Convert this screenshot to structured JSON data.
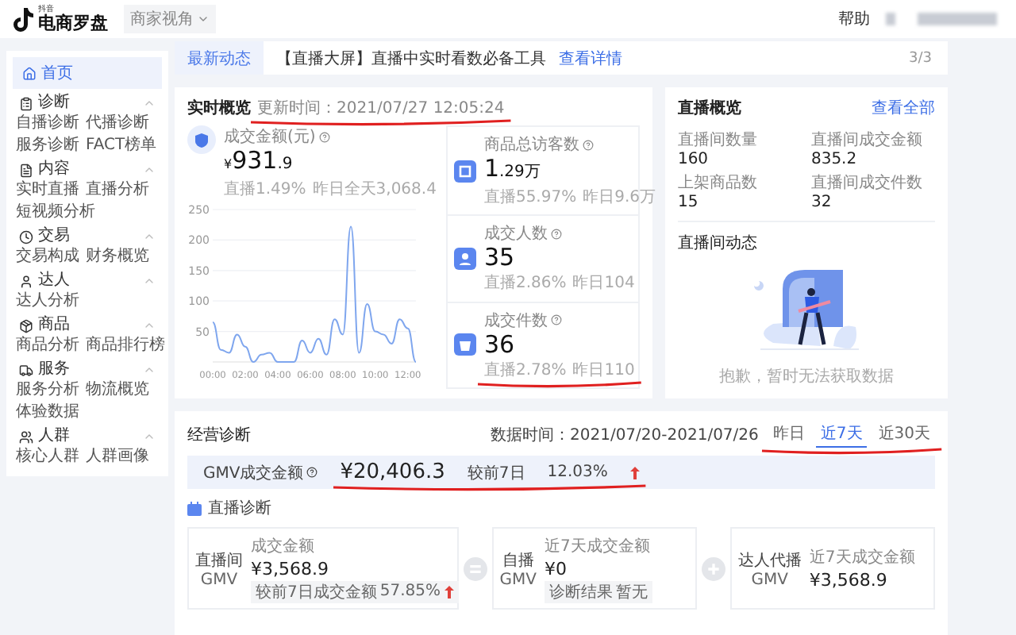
{
  "header": {
    "brand_small": "抖音",
    "brand": "电商罗盘",
    "view_switch": "商家视角",
    "help": "帮助"
  },
  "sidebar": {
    "items": [
      {
        "kind": "link",
        "label": "首页",
        "selected": true
      },
      {
        "kind": "group",
        "label": "诊断",
        "selected": false,
        "expanded": true,
        "children": [
          {
            "label": "自播诊断",
            "selected": false
          },
          {
            "label": "代播诊断",
            "selected": false
          },
          {
            "label": "服务诊断",
            "selected": false
          },
          {
            "label": "FACT榜单",
            "selected": false
          }
        ]
      },
      {
        "kind": "group",
        "label": "内容",
        "selected": false,
        "expanded": true,
        "children": [
          {
            "label": "实时直播",
            "selected": false
          },
          {
            "label": "直播分析",
            "selected": false
          },
          {
            "label": "短视频分析",
            "selected": false
          }
        ]
      },
      {
        "kind": "group",
        "label": "交易",
        "selected": false,
        "expanded": true,
        "children": [
          {
            "label": "交易构成",
            "selected": false
          },
          {
            "label": "财务概览",
            "selected": false
          }
        ]
      },
      {
        "kind": "group",
        "label": "达人",
        "selected": false,
        "expanded": true,
        "children": [
          {
            "label": "达人分析",
            "selected": false
          }
        ]
      },
      {
        "kind": "group",
        "label": "商品",
        "selected": false,
        "expanded": true,
        "children": [
          {
            "label": "商品分析",
            "selected": false
          },
          {
            "label": "商品排行榜",
            "selected": false
          }
        ]
      },
      {
        "kind": "group",
        "label": "服务",
        "selected": false,
        "expanded": true,
        "children": [
          {
            "label": "服务分析",
            "selected": false
          },
          {
            "label": "物流概览",
            "selected": false
          },
          {
            "label": "体验数据",
            "selected": false
          }
        ]
      },
      {
        "kind": "group",
        "label": "人群",
        "selected": false,
        "expanded": true,
        "children": [
          {
            "label": "核心人群",
            "selected": false
          },
          {
            "label": "人群画像",
            "selected": false
          }
        ]
      }
    ]
  },
  "notice": {
    "tab": "最新动态",
    "text": "【直播大屏】直播中实时看数必备工具",
    "link": "查看详情",
    "pager": "3/3"
  },
  "realtime": {
    "title": "实时概览",
    "updated": "更新时间：2021/07/27 12:05:24",
    "main": {
      "label": "成交金额(元)",
      "currency": "¥",
      "value": "931",
      "fraction": ".9",
      "live": "直播1.49%",
      "yesterday": "昨日全天3,068.4"
    },
    "chart_data": {
      "type": "line",
      "grid": true,
      "x": [
        0,
        0.5,
        1,
        1.5,
        2,
        2.5,
        3,
        3.5,
        4,
        4.5,
        5,
        5.5,
        6,
        6.5,
        7,
        7.5,
        8,
        8.5,
        9,
        9.5,
        10,
        10.5,
        11,
        11.5,
        12,
        12.5
      ],
      "series": [
        {
          "color": "#7fa6ee",
          "values": [
            65,
            20,
            15,
            45,
            25,
            0,
            12,
            15,
            0,
            0,
            0,
            35,
            15,
            38,
            12,
            70,
            45,
            222,
            15,
            95,
            50,
            45,
            30,
            70,
            55,
            0
          ]
        }
      ],
      "xlim": [
        0,
        12.5
      ],
      "ylim": [
        0,
        250
      ],
      "yticks": [
        50,
        100,
        150,
        200,
        250
      ],
      "xticks": [
        {
          "value": 0,
          "label": "00:00"
        },
        {
          "value": 2,
          "label": "02:00"
        },
        {
          "value": 4,
          "label": "04:00"
        },
        {
          "value": 6,
          "label": "06:00"
        },
        {
          "value": 8,
          "label": "08:00"
        },
        {
          "value": 10,
          "label": "10:00"
        },
        {
          "value": 12,
          "label": "12:00"
        }
      ]
    },
    "stats": [
      {
        "label": "商品总访客数",
        "value": "1",
        "fraction": ".29万",
        "live": "直播55.97%",
        "yesterday": "昨日9.6万"
      },
      {
        "label": "成交人数",
        "value": "35",
        "live": "直播2.86%",
        "yesterday": "昨日104"
      },
      {
        "label": "成交件数",
        "value": "36",
        "live": "直播2.78%",
        "yesterday": "昨日110"
      }
    ]
  },
  "live_overview": {
    "title": "直播概览",
    "link": "查看全部",
    "metrics": [
      {
        "label": "直播间数量",
        "value": "160"
      },
      {
        "label": "直播间成交金额",
        "value": "835.2"
      },
      {
        "label": "上架商品数",
        "value": "15"
      },
      {
        "label": "直播间成交件数",
        "value": "32"
      }
    ],
    "feed_title": "直播间动态",
    "empty_text": "抱歉，暂时无法获取数据"
  },
  "diagnosis": {
    "title": "经营诊断",
    "period": "数据时间：2021/07/20-2021/07/26",
    "ranges": [
      {
        "label": "昨日",
        "selected": false
      },
      {
        "label": "近7天",
        "selected": true
      },
      {
        "label": "近30天",
        "selected": false
      }
    ],
    "gmv": {
      "label": "GMV成交金额",
      "value": "¥20,406.3",
      "compare": "较前7日",
      "change": "12.03%",
      "rising": true
    },
    "section_title": "直播诊断",
    "cards": [
      {
        "name": "直播间",
        "sub": "GMV",
        "label": "成交金额",
        "value": "¥3,568.9",
        "note": "较前7日成交金额",
        "note_value": "57.85%",
        "rising": true
      },
      {
        "name": "自播",
        "sub": "GMV",
        "label": "近7天成交金额",
        "value": "¥0",
        "note": "诊断结果",
        "note_value": "暂无",
        "rising": false
      },
      {
        "name": "达人代播",
        "sub": "GMV",
        "label": "近7天成交金额",
        "value": "¥3,568.9"
      }
    ]
  }
}
